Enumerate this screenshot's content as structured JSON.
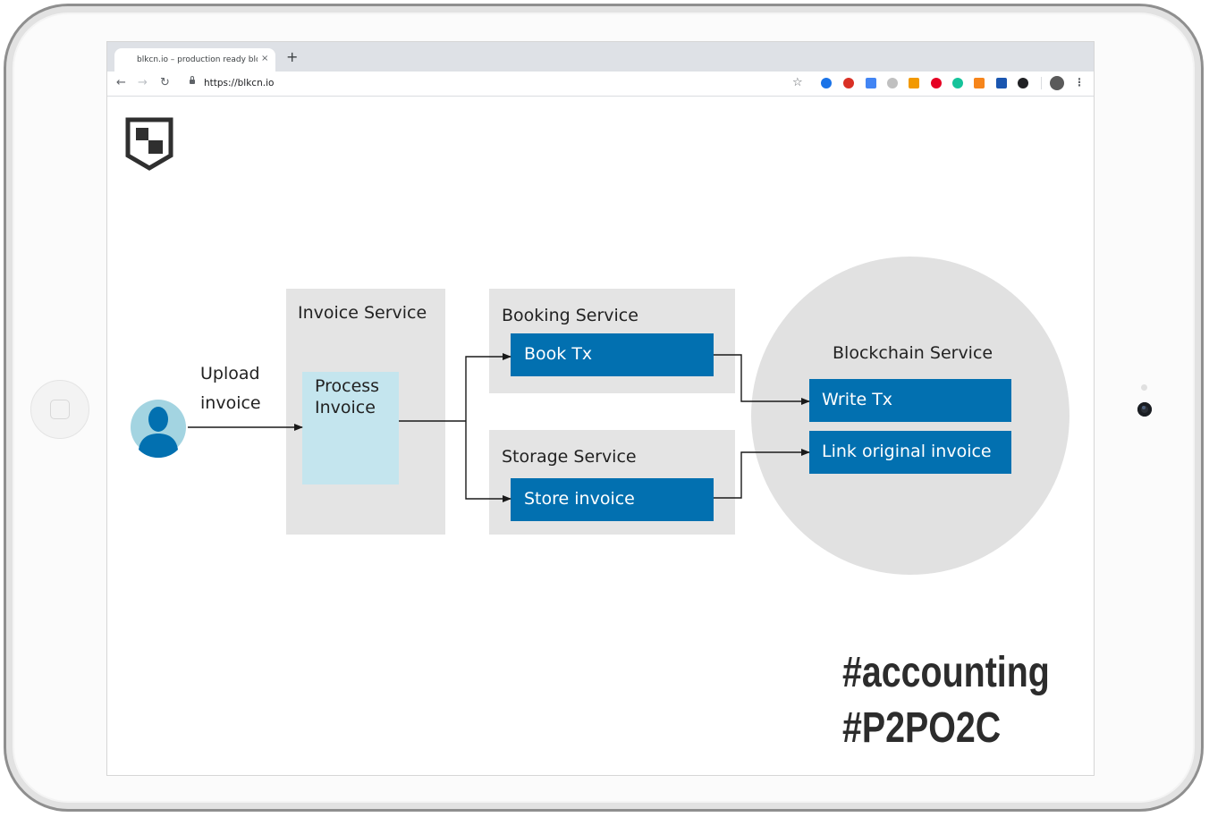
{
  "browser": {
    "tab_title": "blkcn.io – production ready blo",
    "tab_close": "×",
    "new_tab": "+",
    "back": "←",
    "forward": "→",
    "reload": "↻",
    "url": "https://blkcn.io",
    "bookmark": "☆",
    "menu": "⋮"
  },
  "extensions": [
    {
      "name": "ext-1",
      "color": "#1a73e8"
    },
    {
      "name": "abp",
      "color": "#d93025"
    },
    {
      "name": "ext-3",
      "color": "#4285f4"
    },
    {
      "name": "ext-4",
      "color": "#c0c0c0"
    },
    {
      "name": "ext-5",
      "color": "#f29900"
    },
    {
      "name": "pinterest",
      "color": "#e60023"
    },
    {
      "name": "grammarly",
      "color": "#15c39a"
    },
    {
      "name": "metamask",
      "color": "#f6851b"
    },
    {
      "name": "ext-9",
      "color": "#1a56b0"
    },
    {
      "name": "ext-10",
      "color": "#202124"
    }
  ],
  "diagram": {
    "user_label_line1": "Upload",
    "user_label_line2": "invoice",
    "invoice_service": "Invoice Service",
    "process_invoice_line1": "Process",
    "process_invoice_line2": "Invoice",
    "booking_service": "Booking Service",
    "book_tx": "Book Tx",
    "storage_service": "Storage  Service",
    "store_invoice": "Store invoice",
    "blockchain_service": "Blockchain Service",
    "write_tx": "Write Tx",
    "link_original_invoice": "Link original invoice"
  },
  "hashtags": {
    "line1": "#accounting",
    "line2": "#P2PO2C"
  },
  "colors": {
    "service_box": "#e4e4e4",
    "action_box": "#0270b0",
    "process_box": "#c4e5ee",
    "avatar_bg": "#a3d4e1",
    "avatar_fg": "#0270b0",
    "blockchain_circle": "#e1e1e1"
  }
}
